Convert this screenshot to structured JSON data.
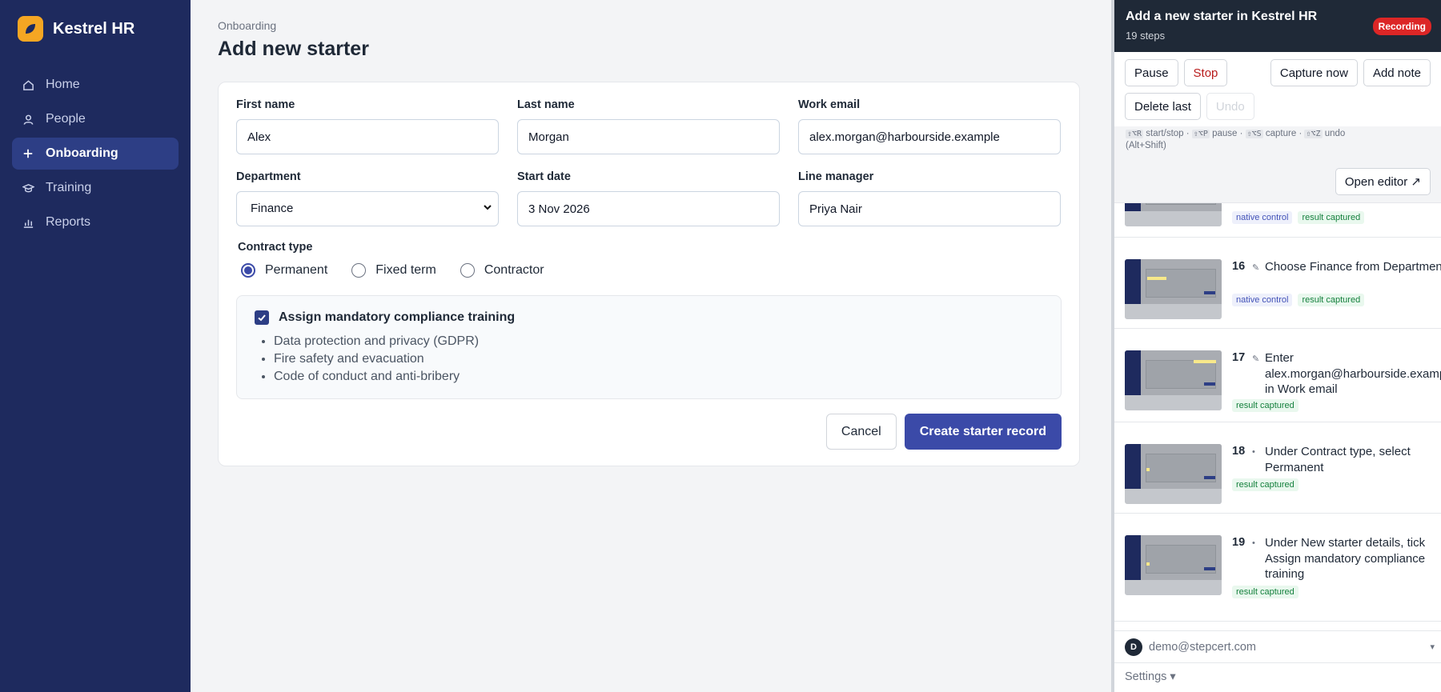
{
  "app": {
    "name": "Kestrel HR",
    "accent": "#3b4aa8",
    "sidebar_bg": "#1e2a5e",
    "logo_color": "#f5a623"
  },
  "nav": [
    {
      "label": "Home",
      "icon": "home-icon"
    },
    {
      "label": "People",
      "icon": "person-icon"
    },
    {
      "label": "Onboarding",
      "icon": "plus-icon",
      "active": true
    },
    {
      "label": "Training",
      "icon": "graduation-cap-icon"
    },
    {
      "label": "Reports",
      "icon": "bar-chart-icon"
    }
  ],
  "page": {
    "breadcrumb": "Onboarding",
    "title": "Add new starter"
  },
  "form": {
    "first_name": {
      "label": "First name",
      "value": "Alex"
    },
    "last_name": {
      "label": "Last name",
      "value": "Morgan"
    },
    "work_email": {
      "label": "Work email",
      "value": "alex.morgan@harbourside.example"
    },
    "department": {
      "label": "Department",
      "value": "Finance"
    },
    "start_date": {
      "label": "Start date",
      "value": "3 Nov 2026"
    },
    "line_manager": {
      "label": "Line manager",
      "value": "Priya Nair"
    },
    "contract": {
      "label": "Contract type",
      "options": [
        "Permanent",
        "Fixed term",
        "Contractor"
      ],
      "selected": "Permanent"
    },
    "compliance": {
      "label": "Assign mandatory compliance training",
      "checked": true,
      "items": [
        "Data protection and privacy (GDPR)",
        "Fire safety and evacuation",
        "Code of conduct and anti-bribery"
      ]
    },
    "cancel_label": "Cancel",
    "submit_label": "Create starter record"
  },
  "recorder": {
    "title": "Add a new starter in Kestrel HR",
    "steps_count": "19 steps",
    "status": "Recording",
    "status_color": "#dc2626",
    "buttons": {
      "pause": "Pause",
      "stop": "Stop",
      "capture": "Capture now",
      "add_note": "Add note",
      "delete_last": "Delete last",
      "undo": "Undo"
    },
    "shortcuts": {
      "k1": "⇧⌥R",
      "t1": "start/stop ·",
      "k2": "⇧⌥P",
      "t2": "pause ·",
      "k3": "⇧⌥S",
      "t3": "capture ·",
      "k4": "⇧⌥Z",
      "t4": "undo",
      "note": "(Alt+Shift)"
    },
    "open_editor": "Open editor ↗",
    "steps": [
      {
        "tags": [
          "native control",
          "result captured"
        ]
      },
      {
        "num": "16",
        "mark": "✎",
        "text": "Choose Finance from Department",
        "tags": [
          "native control",
          "result captured"
        ]
      },
      {
        "num": "17",
        "mark": "✎",
        "text": "Enter alex.morgan@harbourside.example in Work email",
        "tags": [
          "result captured"
        ]
      },
      {
        "num": "18",
        "mark": "•",
        "text": "Under Contract type, select Permanent",
        "tags": [
          "result captured"
        ]
      },
      {
        "num": "19",
        "mark": "•",
        "text": "Under New starter details, tick Assign mandatory compliance training",
        "tags": [
          "result captured"
        ]
      }
    ],
    "user": {
      "initial": "D",
      "email": "demo@stepcert.com",
      "caret": "▾"
    },
    "settings": "Settings ▾"
  }
}
